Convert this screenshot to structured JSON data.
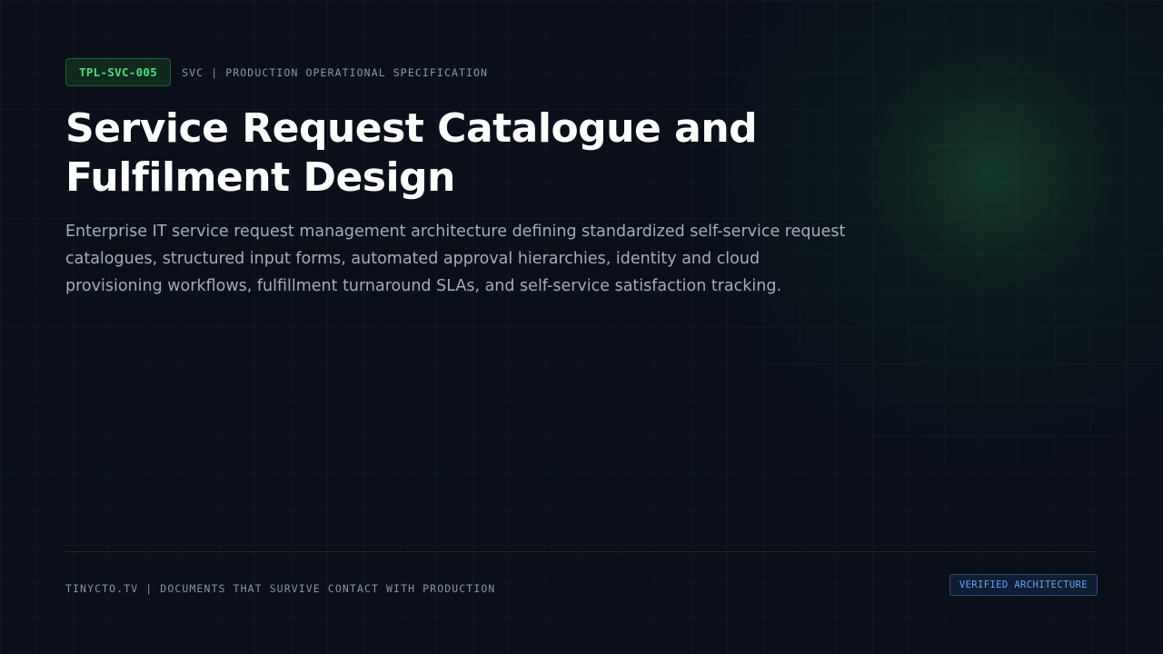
{
  "header": {
    "template_id": "TPL-SVC-005",
    "spec_label": "SVC | PRODUCTION OPERATIONAL SPECIFICATION"
  },
  "main": {
    "title": "Service Request Catalogue and Fulfilment Design",
    "description": "Enterprise IT service request management architecture defining standardized self-service request catalogues, structured input forms, automated approval hierarchies, identity and cloud provisioning workflows, fulfillment turnaround SLAs, and self-service satisfaction tracking."
  },
  "footer": {
    "tagline": "TINYCTO.TV | DOCUMENTS THAT SURVIVE CONTACT WITH PRODUCTION",
    "badge": "VERIFIED ARCHITECTURE"
  },
  "colors": {
    "background": "#0a0f1a",
    "accent_green": "#4ade80",
    "accent_blue": "#60a5fa",
    "title": "#ffffff",
    "body_text": "#a3adbd",
    "muted_text": "#8a96a8"
  }
}
